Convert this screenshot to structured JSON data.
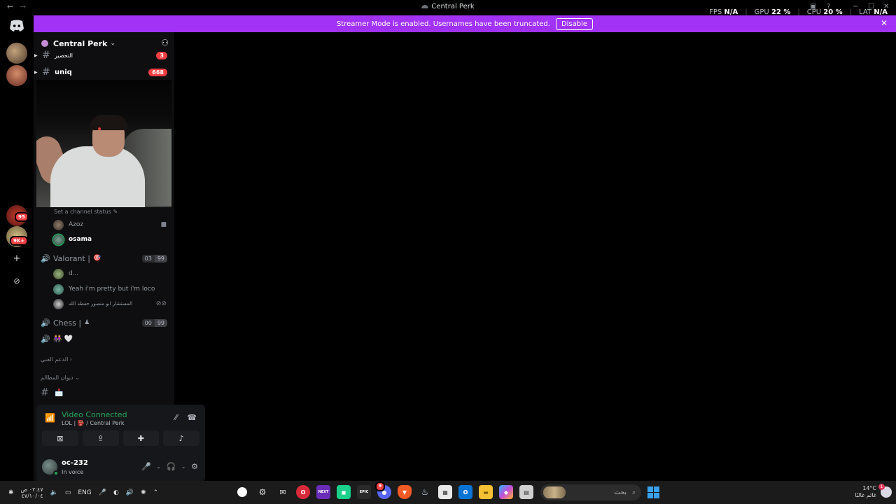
{
  "titlebar": {
    "back": "←",
    "forward": "→",
    "title": "Central Perk",
    "stats": {
      "fps_label": "FPS",
      "fps_value": "N/A",
      "gpu_label": "GPU",
      "gpu_value": "22 %",
      "cpu_label": "CPU",
      "cpu_value": "20 %",
      "lat_label": "LAT",
      "lat_value": "N/A"
    },
    "minimize": "−",
    "maximize": "☐",
    "close": "✕"
  },
  "banner": {
    "message": "Streamer Mode is enabled. Usernames have been truncated.",
    "disable_label": "Disable",
    "close": "✕",
    "color": "#a132f6"
  },
  "rail": {
    "badges": [
      "95",
      "9K+"
    ],
    "add_icon": "+",
    "explore_icon": "⊘"
  },
  "server": {
    "name": "Central Perk",
    "chevron": "⌄",
    "invite_icon": "person-add-icon"
  },
  "channels": [
    {
      "name": "التحضير",
      "count": "3"
    },
    {
      "name": "uniq",
      "count": "668"
    }
  ],
  "channel_status_hint": "Set a channel status",
  "lol_members": [
    {
      "name": "Azoz",
      "right_icon": "■"
    },
    {
      "name": "osama",
      "right_icon": ""
    }
  ],
  "voice_channels": [
    {
      "name": "Valorant |",
      "emoji": "🎯",
      "users": "03",
      "limit": "99"
    },
    {
      "name": "Chess |",
      "emoji": "♟",
      "users": "00",
      "limit": "99"
    },
    {
      "name": "👭 🤍",
      "emoji": "",
      "users": "",
      "limit": ""
    }
  ],
  "valorant_members": [
    {
      "name": "d..."
    },
    {
      "name": "Yeah i'm pretty but i'm loco"
    },
    {
      "name": "المستشار ابو منصور حفظه الله"
    }
  ],
  "categories": [
    {
      "name": "الدعم الفني",
      "arrow": "›"
    },
    {
      "name": "ديوان المظالم",
      "arrow": "⌄"
    }
  ],
  "text_channel_last": {
    "name": "📩"
  },
  "voice_panel": {
    "status": "Video Connected",
    "location": "LOL | 👺 / Central Perk",
    "buttons": [
      "camera-off-icon",
      "screen-share-icon",
      "activities-icon",
      "soundboard-icon"
    ]
  },
  "user": {
    "name": "oc-232",
    "status": "In voice"
  },
  "taskbar": {
    "time": "٠٢:٤٧ ص",
    "date": "٤٧/١٠/٠٤",
    "lang": "ENG",
    "search_label": "بحث",
    "weather_temp": "14°C",
    "weather_text": "غائم غالبًا",
    "notif_count": "1",
    "discord_badge": "9"
  }
}
